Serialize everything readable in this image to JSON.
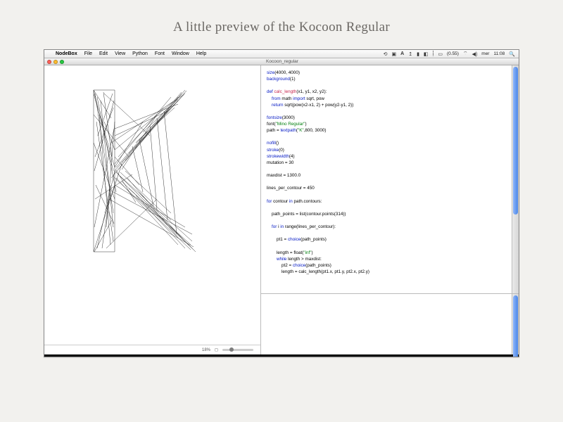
{
  "page": {
    "title": "A little preview of the Kocoon Regular"
  },
  "menubar": {
    "app": "NodeBox",
    "items": [
      "File",
      "Edit",
      "View",
      "Python",
      "Font",
      "Window",
      "Help"
    ],
    "right": {
      "battery": "(0.55)",
      "wifi": "⌁",
      "day": "mer",
      "clock": "11:08"
    }
  },
  "window": {
    "title": "Kocoon_regular"
  },
  "canvas": {
    "zoom": "18%",
    "frame_indicator": "◻"
  },
  "code": {
    "l01a": "size",
    "l01b": "(4000, 4000)",
    "l02a": "background",
    "l02b": "(1)",
    "l03": "",
    "l04a": "def ",
    "l04b": "calc_length",
    "l04c": "(x1, y1, x2, y2):",
    "l05a": "    from ",
    "l05b": "math ",
    "l05c": "import ",
    "l05d": "sqrt, pow",
    "l06a": "    return ",
    "l06b": "sqrt(pow(x2-x1, 2) + pow(y2-y1, 2))",
    "l07": "",
    "l08a": "fontsize",
    "l08b": "(3000)",
    "l09a": "font(",
    "l09b": "\"Mino Regular\"",
    "l09c": ")",
    "l10a": "path = ",
    "l10b": "textpath",
    "l10c": "(",
    "l10d": "\"K\"",
    "l10e": ",800, 3000)",
    "l11": "",
    "l12a": "nofill",
    "l12b": "()",
    "l13a": "stroke",
    "l13b": "(0)",
    "l14a": "strokewidth",
    "l14b": "(4)",
    "l15": "mutation = 30",
    "l16": "",
    "l17": "maxdist = 1300.0",
    "l18": "",
    "l19": "lines_per_contour = 450",
    "l20": "",
    "l21a": "for ",
    "l21b": "contour ",
    "l21c": "in ",
    "l21d": "path.contours:",
    "l22": "",
    "l23": "    path_points = list(contour.points(314))",
    "l24": "",
    "l25a": "    for ",
    "l25b": "i ",
    "l25c": "in ",
    "l25d": "range(lines_per_contour):",
    "l26": "",
    "l27a": "        pt1 = ",
    "l27b": "choice",
    "l27c": "(path_points)",
    "l28": "",
    "l29a": "        length = float(",
    "l29b": "\"inf\"",
    "l29c": ")",
    "l30a": "        while ",
    "l30b": "length > maxdist:",
    "l31a": "            pt2 = ",
    "l31b": "choice",
    "l31c": "(path_points)",
    "l32": "            length = calc_length(pt1.x, pt1.y, pt2.x, pt2.y)"
  }
}
